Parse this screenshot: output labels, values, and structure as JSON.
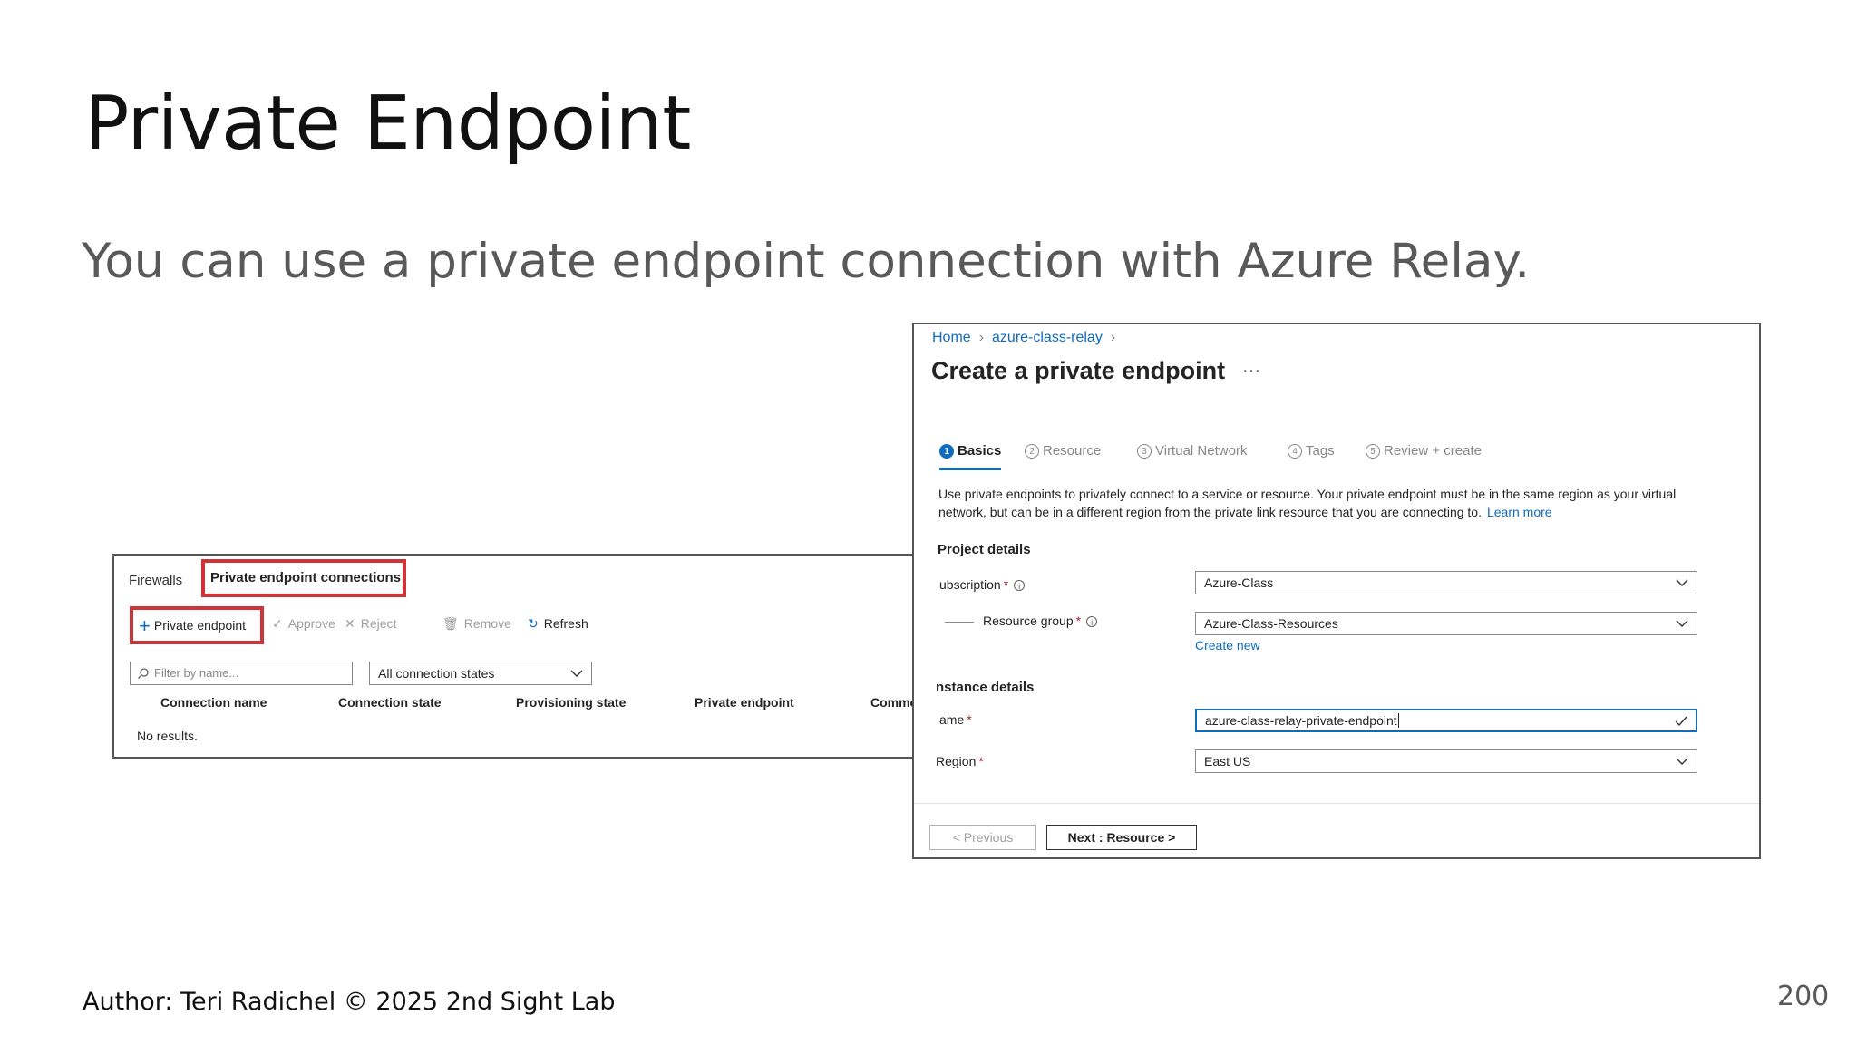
{
  "slide": {
    "title": "Private Endpoint",
    "subtitle": "You can use a private endpoint connection with Azure Relay.",
    "footer": "Author: Teri Radichel © 2025 2nd Sight Lab",
    "page_number": "200"
  },
  "create_pe": {
    "breadcrumb": [
      "Home",
      "azure-class-relay"
    ],
    "title": "Create a private endpoint",
    "more": "···",
    "steps": [
      {
        "num": "1",
        "label": "Basics",
        "active": true
      },
      {
        "num": "2",
        "label": "Resource",
        "active": false
      },
      {
        "num": "3",
        "label": "Virtual Network",
        "active": false
      },
      {
        "num": "4",
        "label": "Tags",
        "active": false
      },
      {
        "num": "5",
        "label": "Review + create",
        "active": false
      }
    ],
    "description": "Use private endpoints to privately connect to a service or resource. Your private endpoint must be in the same region as your virtual network, but can be in a different region from the private link resource that you are connecting to.",
    "learn_more": "Learn more",
    "project_details": "Project details",
    "subscription_label": "ubscription",
    "subscription_value": "Azure-Class",
    "resource_group_label": "Resource group",
    "resource_group_value": "Azure-Class-Resources",
    "create_new": "Create new",
    "instance_details": "nstance details",
    "name_label": "ame",
    "name_value": "azure-class-relay-private-endpoint",
    "region_label": "Region",
    "region_value": "East US",
    "required_mark": "*",
    "prev_button": "< Previous",
    "next_button": "Next : Resource >"
  },
  "connections": {
    "tab_firewalls": "Firewalls",
    "tab_pec": "Private endpoint connections",
    "add_label": "Private endpoint",
    "approve": "Approve",
    "reject": "Reject",
    "remove": "Remove",
    "refresh": "Refresh",
    "filter_placeholder": "Filter by name...",
    "state_filter": "All connection states",
    "columns": [
      "Connection name",
      "Connection state",
      "Provisioning state",
      "Private endpoint",
      "Comments"
    ],
    "empty_text": "No results."
  },
  "colors": {
    "accent": "#0f6cbd",
    "highlight": "#d13438"
  }
}
